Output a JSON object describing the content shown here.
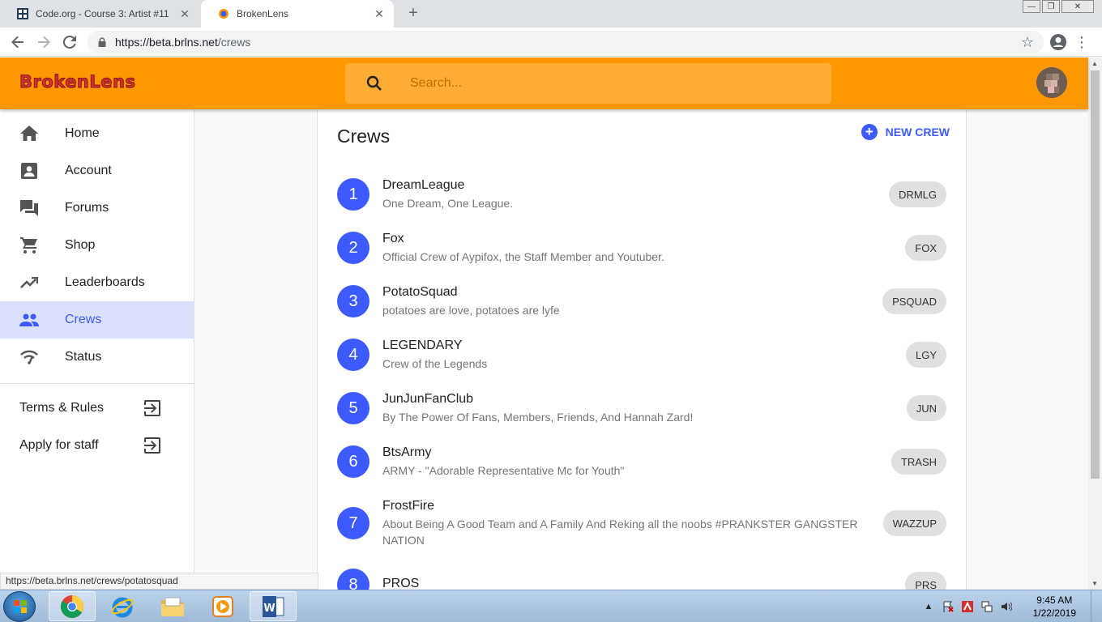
{
  "browser": {
    "tabs": [
      {
        "title": "Code.org - Course 3: Artist #11",
        "active": false
      },
      {
        "title": "BrokenLens",
        "active": true
      }
    ],
    "url_host": "https://beta.brlns.net",
    "url_path": "/crews"
  },
  "header": {
    "logo": "BrokenLens",
    "search_placeholder": "Search..."
  },
  "sidebar": {
    "items": [
      {
        "label": "Home",
        "icon": "home-icon"
      },
      {
        "label": "Account",
        "icon": "account-box-icon"
      },
      {
        "label": "Forums",
        "icon": "forum-icon"
      },
      {
        "label": "Shop",
        "icon": "cart-icon"
      },
      {
        "label": "Leaderboards",
        "icon": "trending-up-icon"
      },
      {
        "label": "Crews",
        "icon": "people-icon",
        "active": true
      },
      {
        "label": "Status",
        "icon": "signal-icon"
      }
    ],
    "links": [
      {
        "label": "Terms & Rules",
        "icon": "exit-to-app-icon"
      },
      {
        "label": "Apply for staff",
        "icon": "exit-to-app-icon"
      }
    ]
  },
  "main": {
    "title": "Crews",
    "new_crew_label": "NEW CREW",
    "crews": [
      {
        "rank": "1",
        "name": "DreamLeague",
        "desc": "One Dream, One League.",
        "tag": "DRMLG"
      },
      {
        "rank": "2",
        "name": "Fox",
        "desc": "Official Crew of Aypifox, the Staff Member and Youtuber.",
        "tag": "FOX"
      },
      {
        "rank": "3",
        "name": "PotatoSquad",
        "desc": "potatoes are love, potatoes are lyfe",
        "tag": "PSQUAD"
      },
      {
        "rank": "4",
        "name": "LEGENDARY",
        "desc": "Crew of the Legends",
        "tag": "LGY"
      },
      {
        "rank": "5",
        "name": "JunJunFanClub",
        "desc": "By The Power Of Fans, Members, Friends, And Hannah Zard!",
        "tag": "JUN"
      },
      {
        "rank": "6",
        "name": "BtsArmy",
        "desc": "ARMY - \"Adorable Representative Mc for Youth\"",
        "tag": "TRASH"
      },
      {
        "rank": "7",
        "name": "FrostFire",
        "desc": "About Being A Good Team and A Family And Reking all the noobs #PRANKSTER GANGSTER NATION",
        "tag": "WAZZUP"
      },
      {
        "rank": "8",
        "name": "PROS",
        "desc": "",
        "tag": "PRS"
      }
    ]
  },
  "status_link": "https://beta.brlns.net/crews/potatosquad",
  "taskbar": {
    "time": "9:45 AM",
    "date": "1/22/2019"
  },
  "colors": {
    "brand_orange": "#ff9800",
    "accent_blue": "#3d5afe",
    "logo_red": "#d32f2f"
  }
}
